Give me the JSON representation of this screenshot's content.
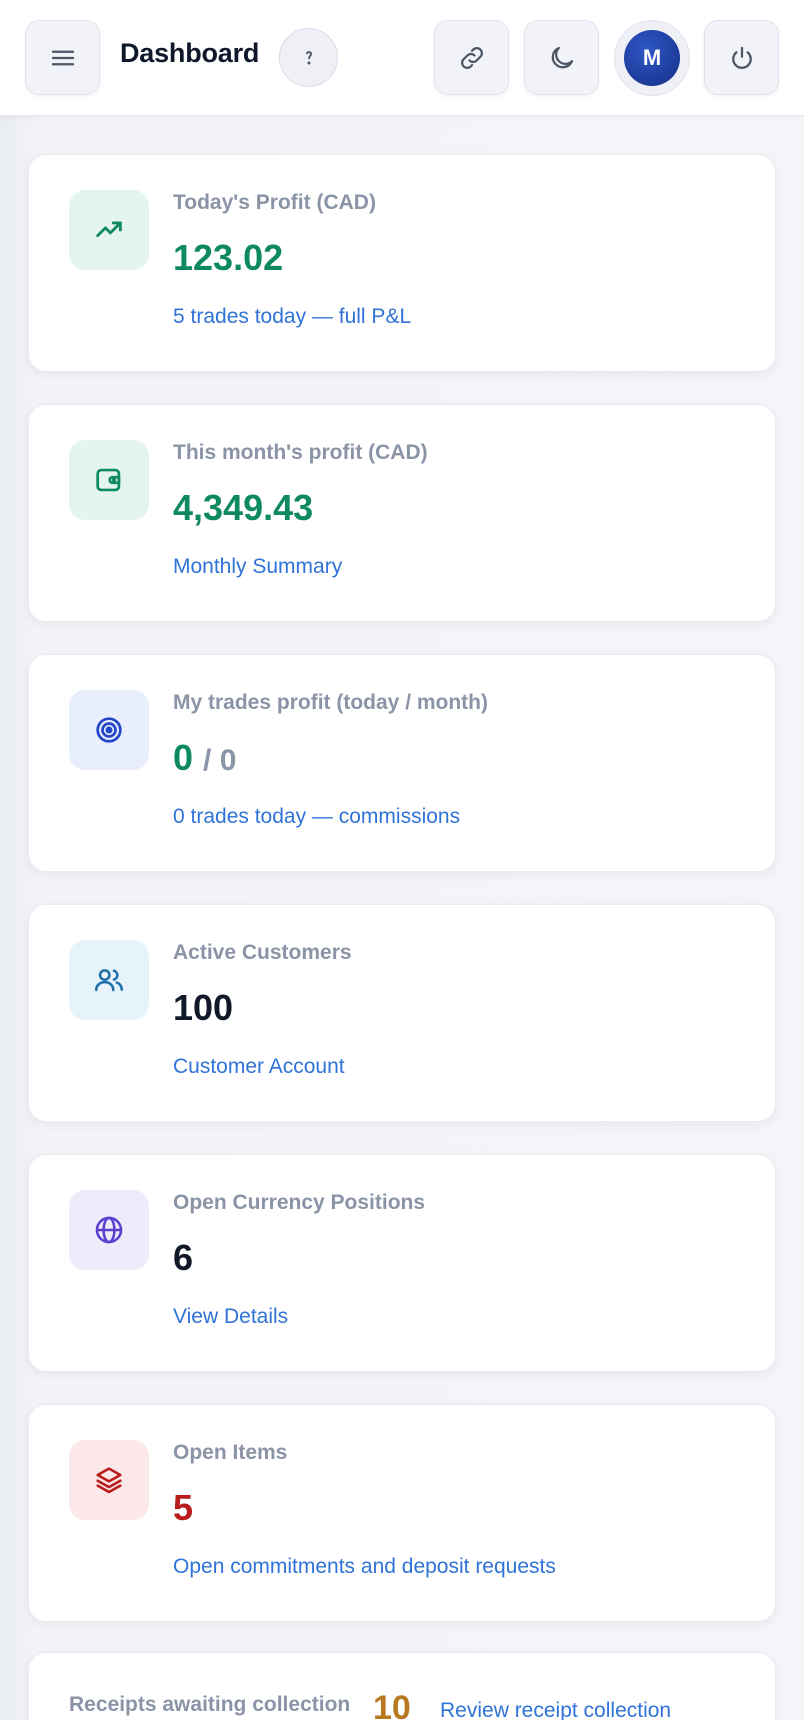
{
  "header": {
    "title": "Dashboard",
    "avatar_initial": "M",
    "icons": [
      "menu-icon",
      "help-icon",
      "link-icon",
      "moon-icon",
      "power-icon"
    ]
  },
  "cards": [
    {
      "label": "Today's Profit (CAD)",
      "value": "123.02",
      "link": "5 trades today — full P&L",
      "icon": "trending-up-icon",
      "accent": "#0f8a5f",
      "icon_bg": "#e3f5ee"
    },
    {
      "label": "This month's profit (CAD)",
      "value": "4,349.43",
      "link": "Monthly Summary",
      "icon": "wallet-icon",
      "accent": "#0f8a5f",
      "icon_bg": "#e3f5ee"
    },
    {
      "label": "My trades profit (today / month)",
      "value": "0",
      "value_secondary": "/ 0",
      "link": "0 trades today — commissions",
      "icon": "target-icon",
      "accent": "#0f8a5f",
      "icon_bg": "#e8eefc"
    },
    {
      "label": "Active Customers",
      "value": "100",
      "link": "Customer Account",
      "icon": "users-icon",
      "accent": "#111827",
      "icon_bg": "#e6f3fb"
    },
    {
      "label": "Open Currency Positions",
      "value": "6",
      "link": "View Details",
      "icon": "globe-icon",
      "accent": "#111827",
      "icon_bg": "#eeebfb"
    },
    {
      "label": "Open Items",
      "value": "5",
      "link": "Open commitments and deposit requests",
      "icon": "layers-icon",
      "accent": "#b91c1c",
      "icon_bg": "#fce8e8"
    }
  ],
  "receipts": {
    "label": "Receipts awaiting collection",
    "value": "10",
    "link": "Review receipt collection"
  }
}
